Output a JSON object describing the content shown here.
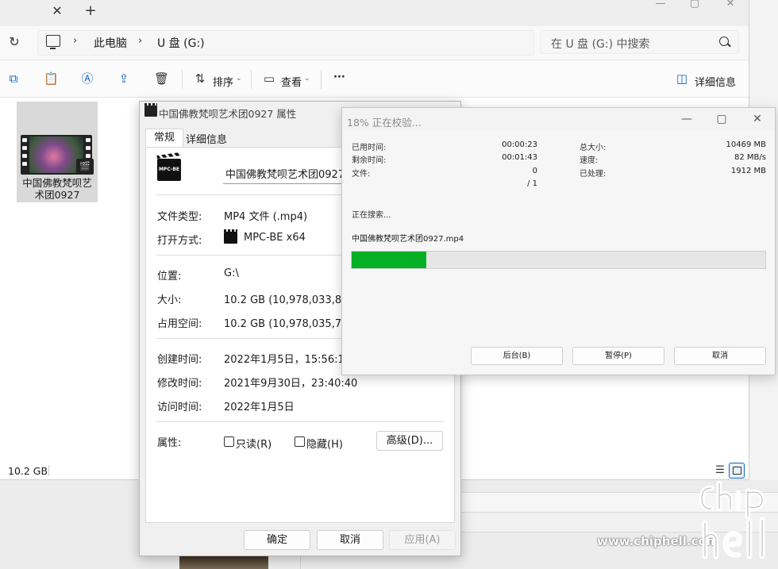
{
  "explorer": {
    "tab_close": "✕",
    "tab_new": "+",
    "controls": {
      "minimize": "—",
      "maximize": "▢",
      "close": "✕"
    },
    "breadcrumb": {
      "sep": "›",
      "pc": "此电脑",
      "drive": "U 盘 (G:)"
    },
    "search_placeholder": "在 U 盘 (G:) 中搜索",
    "toolbar": {
      "sort": "排序",
      "view": "查看",
      "more": "···",
      "details": "详细信息"
    },
    "file": {
      "name_line1": "中国佛教梵呗艺",
      "name_line2": "术团0927"
    },
    "status": {
      "size": "10.2 GB"
    }
  },
  "properties": {
    "title": "中国佛教梵呗艺术团0927 属性",
    "tabs": {
      "general": "常规",
      "details": "详细信息"
    },
    "file_name": "中国佛教梵呗艺术团0927",
    "file_icon_label": "MPC-BE",
    "rows": {
      "type": {
        "label": "文件类型:",
        "value": "MP4 文件 (.mp4)"
      },
      "open_with": {
        "label": "打开方式:",
        "value": "MPC-BE x64"
      },
      "location": {
        "label": "位置:",
        "value": "G:\\"
      },
      "size": {
        "label": "大小:",
        "value": "10.2 GB (10,978,033,801 字"
      },
      "size_on_disk": {
        "label": "占用空间:",
        "value": "10.2 GB (10,978,035,712 字"
      },
      "created": {
        "label": "创建时间:",
        "value": "2022年1月5日，15:56:11"
      },
      "modified": {
        "label": "修改时间:",
        "value": "2021年9月30日，23:40:40"
      },
      "accessed": {
        "label": "访问时间:",
        "value": "2022年1月5日"
      }
    },
    "attributes": {
      "label": "属性:",
      "readonly": "只读(R)",
      "hidden": "隐藏(H)",
      "advanced": "高级(D)..."
    },
    "buttons": {
      "ok": "确定",
      "cancel": "取消",
      "apply": "应用(A)"
    }
  },
  "verify": {
    "title": "18% 正在校验...",
    "progress_fraction": 0.18,
    "controls": {
      "minimize": "—",
      "maximize": "▢",
      "close": "✕"
    },
    "elapsed_label": "已用时间:",
    "elapsed": "00:00:23",
    "remaining_label": "剩余时间:",
    "remaining": "00:01:43",
    "files_label": "文件:",
    "files": "0",
    "files_total": "/ 1",
    "total_label": "总大小:",
    "total": "10469 MB",
    "speed_label": "速度:",
    "speed": "82 MB/s",
    "processed_label": "已处理:",
    "processed": "1912 MB",
    "status": "正在搜索...",
    "current_file": "中国佛教梵呗艺术团0927.mp4",
    "buttons": {
      "background": "后台(B)",
      "pause": "暂停(P)",
      "cancel": "取消"
    }
  },
  "watermark": {
    "url": "www.chiphell.com",
    "logo": "chip hell"
  }
}
